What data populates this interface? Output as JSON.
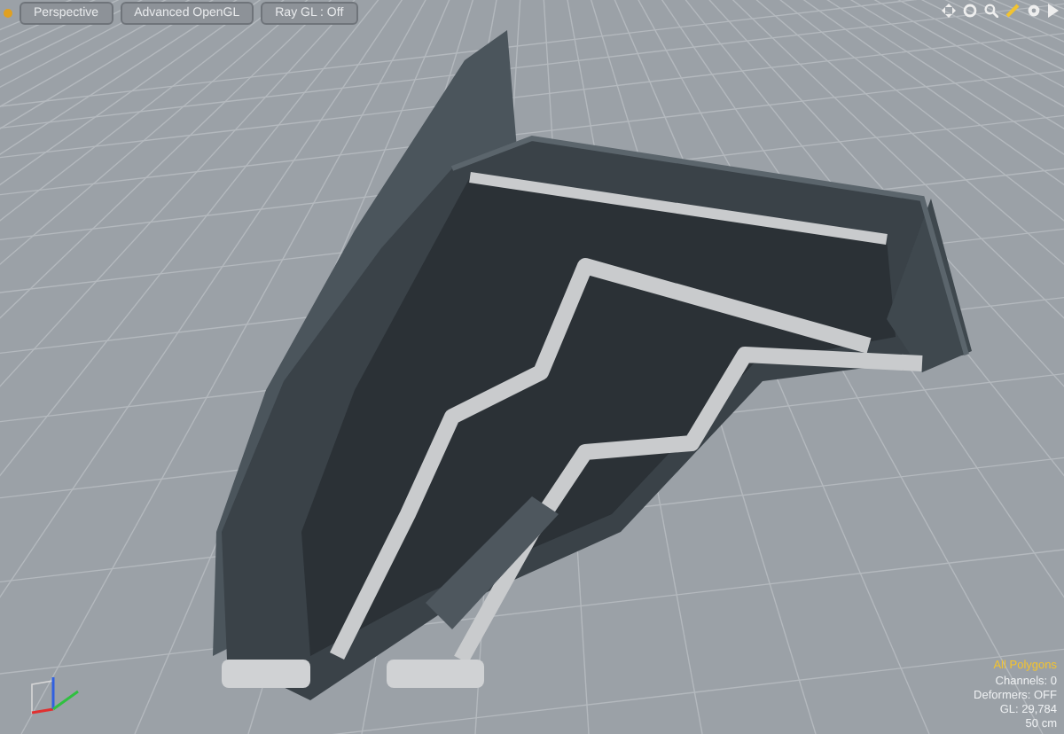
{
  "viewport": {
    "buttons": [
      {
        "label": "Perspective"
      },
      {
        "label": "Advanced OpenGL"
      },
      {
        "label": "Ray GL : Off"
      }
    ],
    "info": [
      {
        "kind": "selection",
        "text": "All Polygons"
      },
      {
        "kind": "stat",
        "text": "Channels: 0"
      },
      {
        "kind": "stat",
        "text": "Deformers: OFF"
      },
      {
        "kind": "stat",
        "text": "GL: 29,784"
      },
      {
        "kind": "stat",
        "text": "50 cm"
      }
    ]
  }
}
